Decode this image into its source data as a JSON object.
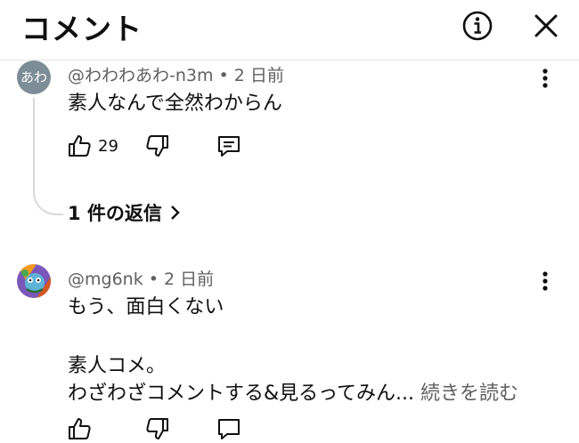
{
  "header": {
    "title": "コメント",
    "info_icon": "info-circle-icon",
    "close_icon": "close-icon"
  },
  "comments": [
    {
      "avatar_text": "あわ",
      "avatar_color": "#7d8d97",
      "meta": "@わわわあわ-n3m • 2 日前",
      "lines": [
        "素人なんで全然わからん"
      ],
      "likes": "29",
      "replies_label": "1 件の返信"
    },
    {
      "avatar_icon": "cartoon-character-avatar",
      "meta": "@mg6nk • 2 日前",
      "lines": [
        "もう、面白くない",
        "素人コメ。",
        "わざわざコメントする&見るってみん..."
      ],
      "read_more": "続きを読む"
    }
  ]
}
